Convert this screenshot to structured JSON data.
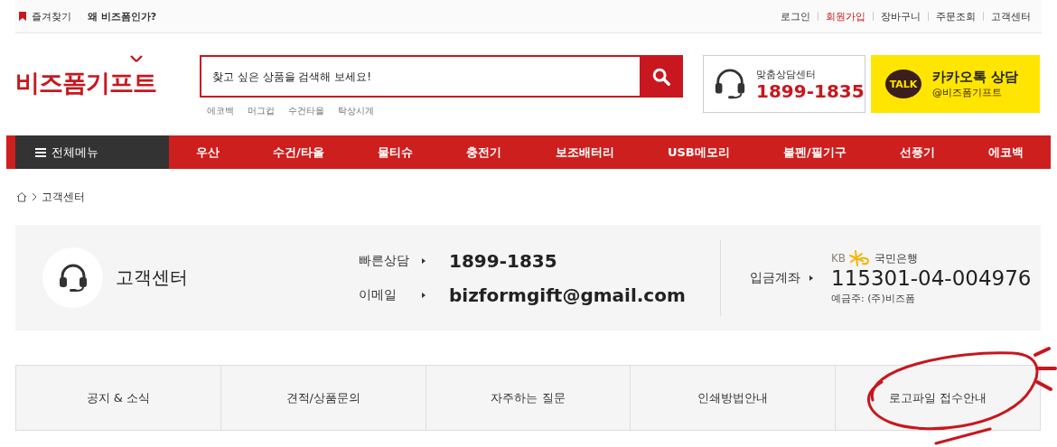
{
  "top_bar": {
    "left": [
      {
        "label": "즐겨찾기",
        "kind": "bookmark"
      },
      {
        "label": "왜 비즈폼인가?",
        "kind": "bold"
      }
    ],
    "links": [
      {
        "label": "로그인",
        "highlight": false
      },
      {
        "label": "회원가입",
        "highlight": true
      },
      {
        "label": "장바구니",
        "highlight": false
      },
      {
        "label": "주문조회",
        "highlight": false
      },
      {
        "label": "고객센터",
        "highlight": false
      }
    ]
  },
  "header": {
    "logo": "비즈폼기프트",
    "search": {
      "placeholder": "찾고 싶은 상품을 검색해 보세요!"
    },
    "keywords": [
      "에코백",
      "머그컵",
      "수건타올",
      "탁상시계"
    ],
    "call": {
      "label": "맞춤상담센터",
      "number": "1899-1835"
    },
    "kakao": {
      "badge": "TALK",
      "title": "카카오톡 상담",
      "handle": "@비즈폼기프트"
    }
  },
  "nav": {
    "all_menu": "전체메뉴",
    "items": [
      "우산",
      "수건/타올",
      "물티슈",
      "충전기",
      "보조배터리",
      "USB메모리",
      "볼펜/필기구",
      "선풍기",
      "에코백"
    ]
  },
  "breadcrumb": [
    "고객센터"
  ],
  "info": {
    "title": "고객센터",
    "contacts": [
      {
        "label": "빠른상담",
        "value": "1899-1835"
      },
      {
        "label": "이메일",
        "value": "bizformgift@gmail.com"
      }
    ],
    "bank": {
      "label": "입금계좌",
      "logo": "KB",
      "name": "국민은행",
      "account": "115301-04-004976",
      "holder": "예금주: (주)비즈폼"
    }
  },
  "tabs": [
    {
      "label": "공지 & 소식",
      "circled": false
    },
    {
      "label": "견적/상품문의",
      "circled": false
    },
    {
      "label": "자주하는 질문",
      "circled": false
    },
    {
      "label": "인쇄방법안내",
      "circled": false
    },
    {
      "label": "로고파일 접수안내",
      "circled": true
    }
  ]
}
